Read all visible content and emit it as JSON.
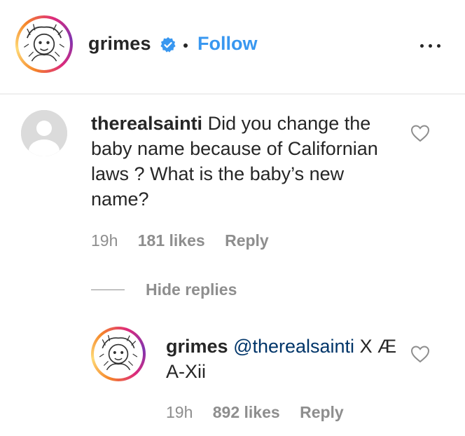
{
  "header": {
    "username": "grimes",
    "separator": "•",
    "follow_label": "Follow",
    "verified_icon": "verified-badge-icon",
    "more_icon": "more-options-icon",
    "accent_color": "#3897f0"
  },
  "comment": {
    "username": "therealsainti",
    "text": "Did you change the baby name because of Californian laws ? What is the baby’s new name?",
    "timestamp": "19h",
    "likes": "181 likes",
    "reply_label": "Reply",
    "like_icon": "heart-outline-icon"
  },
  "replies_toggle": {
    "label": "Hide replies"
  },
  "reply": {
    "username": "grimes",
    "mention": "@therealsainti",
    "text": "X Æ A-Xii",
    "timestamp": "19h",
    "likes": "892 likes",
    "reply_label": "Reply",
    "like_icon": "heart-outline-icon"
  }
}
